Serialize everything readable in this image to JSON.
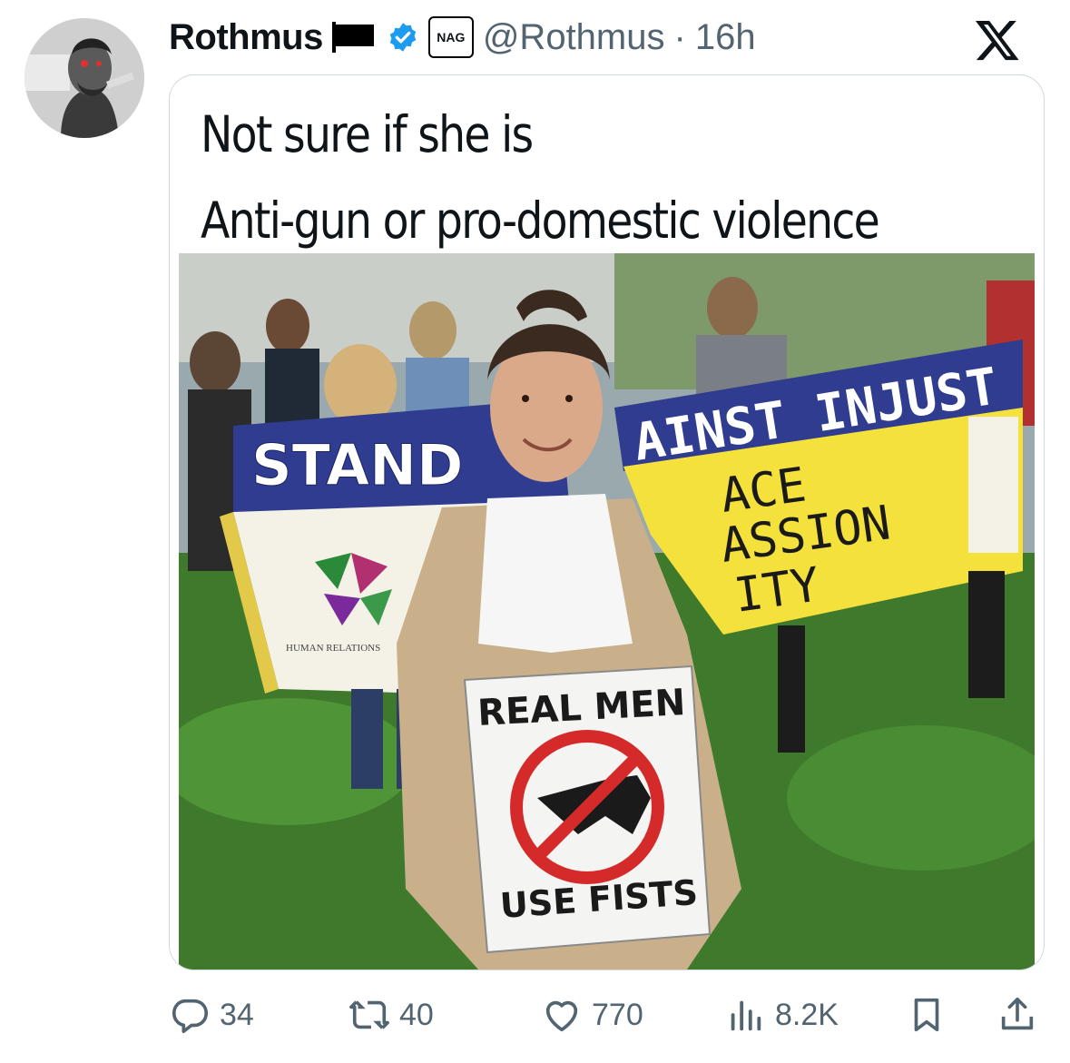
{
  "tweet": {
    "author_name": "Rothmus",
    "handle": "@Rothmus",
    "separator": "·",
    "time": "16h",
    "affiliation_badge": "NAG",
    "caption_line1": "Not sure if she is",
    "caption_line2": "Anti-gun or pro-domestic violence"
  },
  "image_text": {
    "banner_left": "STAND",
    "banner_right_top": "AINST INJUST",
    "banner_right_line1": "ACE",
    "banner_right_line2": "ASSION",
    "banner_right_line3": "ITY",
    "banner_logo_text": "HUMAN RELATIONS",
    "sign_top": "REAL MEN",
    "sign_bottom": "USE FISTS"
  },
  "actions": {
    "replies": "34",
    "reposts": "40",
    "likes": "770",
    "views": "8.2K"
  },
  "icons": [
    "avatar",
    "flag-icon",
    "verified-badge-icon",
    "x-logo-icon",
    "reply-icon",
    "repost-icon",
    "like-icon",
    "views-icon",
    "bookmark-icon",
    "share-icon"
  ],
  "colors": {
    "verified": "#1d9bf0",
    "muted": "#536471",
    "banner_blue": "#2f3c8f",
    "banner_yellow": "#f5e13b"
  }
}
